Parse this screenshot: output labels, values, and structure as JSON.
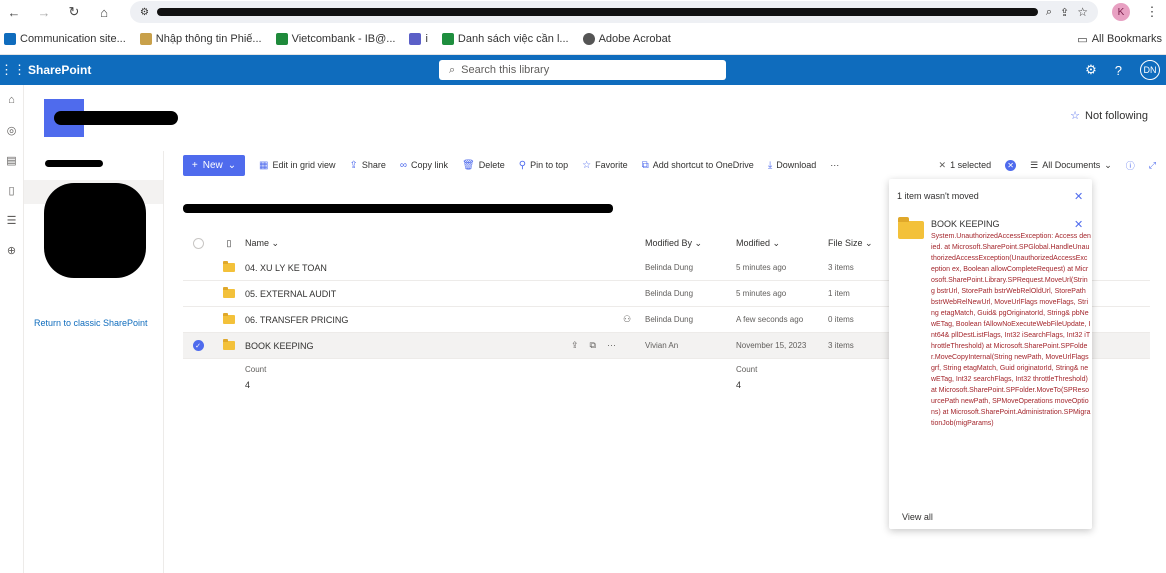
{
  "browser": {
    "profile_initial": "K",
    "bookmarks": [
      {
        "label": "Communication site...",
        "color": "#0f6cbd"
      },
      {
        "label": "Nhập thông tin Phiế...",
        "color": "#c8a04a"
      },
      {
        "label": "Vietcombank - IB@...",
        "color": "#1f8a3b"
      },
      {
        "label": "i",
        "color": "#5b5fc7"
      },
      {
        "label": "Danh sách việc cần l...",
        "color": "#1e8e3e"
      },
      {
        "label": "Adobe Acrobat",
        "color": "#555555"
      }
    ],
    "all_bookmarks": "All Bookmarks"
  },
  "suite": {
    "app_name": "SharePoint",
    "search_placeholder": "Search this library",
    "avatar_initials": "DN"
  },
  "site": {
    "follow_label": "Not following",
    "return_classic": "Return to classic SharePoint"
  },
  "commands": {
    "new": "New",
    "items": [
      "Edit in grid view",
      "Share",
      "Copy link",
      "Delete",
      "Pin to top",
      "Favorite",
      "Add shortcut to OneDrive",
      "Download",
      "···"
    ],
    "selected": "1 selected",
    "view": "All Documents"
  },
  "table": {
    "headers": {
      "name": "Name",
      "modified_by": "Modified By",
      "modified": "Modified",
      "file_size": "File Size"
    },
    "rows": [
      {
        "name": "04. XU LY KE TOAN",
        "modified_by": "Belinda Dung",
        "modified": "5 minutes ago",
        "size": "3 items"
      },
      {
        "name": "05. EXTERNAL AUDIT",
        "modified_by": "Belinda Dung",
        "modified": "5 minutes ago",
        "size": "1 item"
      },
      {
        "name": "06. TRANSFER PRICING",
        "modified_by": "Belinda Dung",
        "modified": "A few seconds ago",
        "size": "0 items"
      },
      {
        "name": "BOOK KEEPING",
        "modified_by": "Vivian An",
        "modified": "November 15, 2023",
        "size": "3 items"
      }
    ],
    "count_label": "Count",
    "count_name": "4",
    "count_modified": "4"
  },
  "notification": {
    "header": "1 item wasn't moved",
    "item_title": "BOOK KEEPING",
    "error": "System.UnauthorizedAccessException: Access denied. at Microsoft.SharePoint.SPGlobal.HandleUnauthorizedAccessException(UnauthorizedAccessException ex, Boolean allowCompleteRequest) at Microsoft.SharePoint.Library.SPRequest.MoveUrl(String bstrUrl, StorePath bstrWebRelOldUrl, StorePath bstrWebRelNewUrl, MoveUrlFlags moveFlags, String etagMatch, Guid& pgOriginatorId, String& pbNewETag, Boolean fAllowNoExecuteWebFileUpdate, Int64& pllDestListFlags, Int32 iSearchFlags, Int32 iThrottleThreshold) at Microsoft.SharePoint.SPFolder.MoveCopyInternal(String newPath, MoveUrlFlags grf, String etagMatch, Guid originatorId, String& newETag, Int32 searchFlags, Int32 throttleThreshold) at Microsoft.SharePoint.SPFolder.MoveTo(SPResourcePath newPath, SPMoveOperations moveOptions) at Microsoft.SharePoint.Administration.SPMigrationJob(migParams)",
    "view_all": "View all"
  }
}
